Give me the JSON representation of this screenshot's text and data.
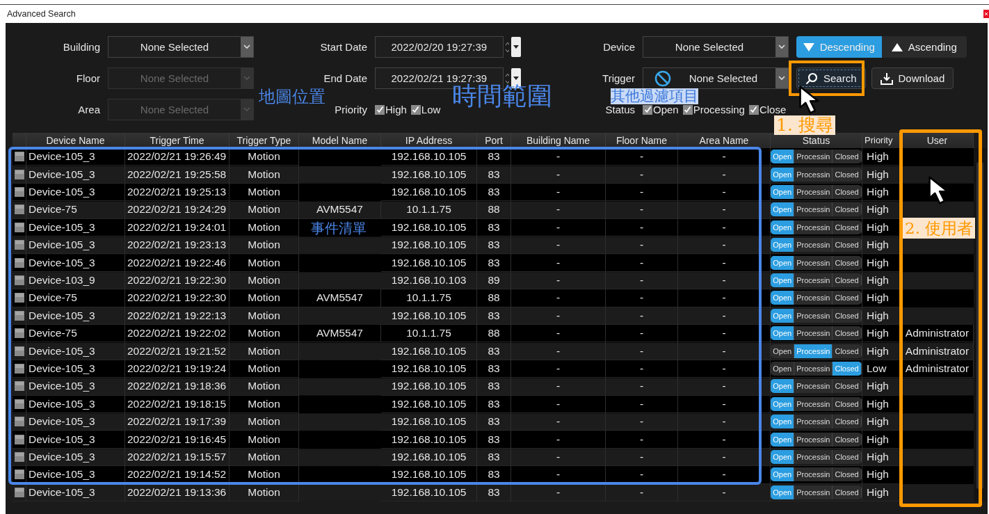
{
  "window": {
    "title": "Advanced Search"
  },
  "filters": {
    "location": [
      {
        "label": "Building",
        "value": "None Selected",
        "disabled": false
      },
      {
        "label": "Floor",
        "value": "None Selected",
        "disabled": true
      },
      {
        "label": "Area",
        "value": "None Selected",
        "disabled": true
      }
    ],
    "dates": [
      {
        "label": "Start Date",
        "value": "2022/02/20 19:27:39"
      },
      {
        "label": "End Date",
        "value": "2022/02/21 19:27:39"
      }
    ],
    "priority": {
      "label": "Priority",
      "options": [
        {
          "label": "High",
          "checked": true
        },
        {
          "label": "Low",
          "checked": true
        }
      ]
    },
    "device": {
      "label": "Device",
      "value": "None Selected"
    },
    "trigger": {
      "label": "Trigger",
      "value": "None Selected"
    },
    "status": {
      "label": "Status",
      "options": [
        {
          "label": "Open",
          "checked": true
        },
        {
          "label": "Processing",
          "checked": true
        },
        {
          "label": "Close",
          "checked": true
        }
      ]
    },
    "sort": [
      {
        "label": "Descending",
        "kind": "down",
        "selected": true
      },
      {
        "label": "Ascending",
        "kind": "up",
        "selected": false
      }
    ],
    "actions": [
      {
        "label": "Search",
        "kind": "search"
      },
      {
        "label": "Download",
        "kind": "download"
      }
    ]
  },
  "table": {
    "columns": [
      "Device Name",
      "Trigger Time",
      "Trigger Type",
      "Model Name",
      "IP Address",
      "Port",
      "Building Name",
      "Floor Name",
      "Area Name",
      "Status",
      "Priority",
      "User"
    ],
    "rows": [
      {
        "device": "Device-105_3",
        "time": "2022/02/21 19:26:49",
        "type": "Motion",
        "ip": "192.168.10.105",
        "port": "83",
        "building": "-",
        "floor": "-",
        "area": "-",
        "status": [
          {
            "label": "Open",
            "selected": true
          },
          {
            "label": "Processin",
            "selected": false
          },
          {
            "label": "Closed",
            "selected": false
          }
        ],
        "priority": "High"
      },
      {
        "device": "Device-105_3",
        "time": "2022/02/21 19:25:58",
        "type": "Motion",
        "ip": "192.168.10.105",
        "port": "83",
        "building": "-",
        "floor": "-",
        "area": "-",
        "status": [
          {
            "label": "Open",
            "selected": true
          },
          {
            "label": "Processin",
            "selected": false
          },
          {
            "label": "Closed",
            "selected": false
          }
        ],
        "priority": "High"
      },
      {
        "device": "Device-105_3",
        "time": "2022/02/21 19:25:13",
        "type": "Motion",
        "ip": "192.168.10.105",
        "port": "83",
        "building": "-",
        "floor": "-",
        "area": "-",
        "status": [
          {
            "label": "Open",
            "selected": true
          },
          {
            "label": "Processin",
            "selected": false
          },
          {
            "label": "Closed",
            "selected": false
          }
        ],
        "priority": "High"
      },
      {
        "device": "Device-75",
        "time": "2022/02/21 19:24:29",
        "type": "Motion",
        "model": "AVM5547",
        "ip": "10.1.1.75",
        "port": "88",
        "building": "-",
        "floor": "-",
        "area": "-",
        "status": [
          {
            "label": "Open",
            "selected": true
          },
          {
            "label": "Processin",
            "selected": false
          },
          {
            "label": "Closed",
            "selected": false
          }
        ],
        "priority": "High"
      },
      {
        "device": "Device-105_3",
        "time": "2022/02/21 19:24:01",
        "type": "Motion",
        "ip": "192.168.10.105",
        "port": "83",
        "building": "-",
        "floor": "-",
        "area": "-",
        "status": [
          {
            "label": "Open",
            "selected": true
          },
          {
            "label": "Processin",
            "selected": false
          },
          {
            "label": "Closed",
            "selected": false
          }
        ],
        "priority": "High"
      },
      {
        "device": "Device-105_3",
        "time": "2022/02/21 19:23:13",
        "type": "Motion",
        "ip": "192.168.10.105",
        "port": "83",
        "building": "-",
        "floor": "-",
        "area": "-",
        "status": [
          {
            "label": "Open",
            "selected": true
          },
          {
            "label": "Processin",
            "selected": false
          },
          {
            "label": "Closed",
            "selected": false
          }
        ],
        "priority": "High"
      },
      {
        "device": "Device-105_3",
        "time": "2022/02/21 19:22:46",
        "type": "Motion",
        "ip": "192.168.10.105",
        "port": "83",
        "building": "-",
        "floor": "-",
        "area": "-",
        "status": [
          {
            "label": "Open",
            "selected": true
          },
          {
            "label": "Processin",
            "selected": false
          },
          {
            "label": "Closed",
            "selected": false
          }
        ],
        "priority": "High"
      },
      {
        "device": "Device-103_9",
        "time": "2022/02/21 19:22:30",
        "type": "Motion",
        "ip": "192.168.10.103",
        "port": "89",
        "building": "-",
        "floor": "-",
        "area": "-",
        "status": [
          {
            "label": "Open",
            "selected": true
          },
          {
            "label": "Processin",
            "selected": false
          },
          {
            "label": "Closed",
            "selected": false
          }
        ],
        "priority": "High"
      },
      {
        "device": "Device-75",
        "time": "2022/02/21 19:22:30",
        "type": "Motion",
        "model": "AVM5547",
        "ip": "10.1.1.75",
        "port": "88",
        "building": "-",
        "floor": "-",
        "area": "-",
        "status": [
          {
            "label": "Open",
            "selected": true
          },
          {
            "label": "Processin",
            "selected": false
          },
          {
            "label": "Closed",
            "selected": false
          }
        ],
        "priority": "High"
      },
      {
        "device": "Device-105_3",
        "time": "2022/02/21 19:22:13",
        "type": "Motion",
        "ip": "192.168.10.105",
        "port": "83",
        "building": "-",
        "floor": "-",
        "area": "-",
        "status": [
          {
            "label": "Open",
            "selected": true
          },
          {
            "label": "Processin",
            "selected": false
          },
          {
            "label": "Closed",
            "selected": false
          }
        ],
        "priority": "High"
      },
      {
        "device": "Device-75",
        "time": "2022/02/21 19:22:02",
        "type": "Motion",
        "model": "AVM5547",
        "ip": "10.1.1.75",
        "port": "88",
        "building": "-",
        "floor": "-",
        "area": "-",
        "status": [
          {
            "label": "Open",
            "selected": true
          },
          {
            "label": "Processin",
            "selected": false
          },
          {
            "label": "Closed",
            "selected": false
          }
        ],
        "priority": "High",
        "user": "Administrator"
      },
      {
        "device": "Device-105_3",
        "time": "2022/02/21 19:21:52",
        "type": "Motion",
        "ip": "192.168.10.105",
        "port": "83",
        "building": "-",
        "floor": "-",
        "area": "-",
        "status": [
          {
            "label": "Open",
            "selected": false
          },
          {
            "label": "Processin",
            "selected": true
          },
          {
            "label": "Closed",
            "selected": false
          }
        ],
        "priority": "High",
        "user": "Administrator"
      },
      {
        "device": "Device-105_3",
        "time": "2022/02/21 19:19:24",
        "type": "Motion",
        "ip": "192.168.10.105",
        "port": "83",
        "building": "-",
        "floor": "-",
        "area": "-",
        "status": [
          {
            "label": "Open",
            "selected": false
          },
          {
            "label": "Processin",
            "selected": false
          },
          {
            "label": "Closed",
            "selected": true
          }
        ],
        "priority": "Low",
        "user": "Administrator"
      },
      {
        "device": "Device-105_3",
        "time": "2022/02/21 19:18:36",
        "type": "Motion",
        "ip": "192.168.10.105",
        "port": "83",
        "building": "-",
        "floor": "-",
        "area": "-",
        "status": [
          {
            "label": "Open",
            "selected": true
          },
          {
            "label": "Processin",
            "selected": false
          },
          {
            "label": "Closed",
            "selected": false
          }
        ],
        "priority": "High"
      },
      {
        "device": "Device-105_3",
        "time": "2022/02/21 19:18:15",
        "type": "Motion",
        "ip": "192.168.10.105",
        "port": "83",
        "building": "-",
        "floor": "-",
        "area": "-",
        "status": [
          {
            "label": "Open",
            "selected": true
          },
          {
            "label": "Processin",
            "selected": false
          },
          {
            "label": "Closed",
            "selected": false
          }
        ],
        "priority": "High"
      },
      {
        "device": "Device-105_3",
        "time": "2022/02/21 19:17:39",
        "type": "Motion",
        "ip": "192.168.10.105",
        "port": "83",
        "building": "-",
        "floor": "-",
        "area": "-",
        "status": [
          {
            "label": "Open",
            "selected": true
          },
          {
            "label": "Processin",
            "selected": false
          },
          {
            "label": "Closed",
            "selected": false
          }
        ],
        "priority": "High"
      },
      {
        "device": "Device-105_3",
        "time": "2022/02/21 19:16:45",
        "type": "Motion",
        "ip": "192.168.10.105",
        "port": "83",
        "building": "-",
        "floor": "-",
        "area": "-",
        "status": [
          {
            "label": "Open",
            "selected": true
          },
          {
            "label": "Processin",
            "selected": false
          },
          {
            "label": "Closed",
            "selected": false
          }
        ],
        "priority": "High"
      },
      {
        "device": "Device-105_3",
        "time": "2022/02/21 19:15:57",
        "type": "Motion",
        "ip": "192.168.10.105",
        "port": "83",
        "building": "-",
        "floor": "-",
        "area": "-",
        "status": [
          {
            "label": "Open",
            "selected": true
          },
          {
            "label": "Processin",
            "selected": false
          },
          {
            "label": "Closed",
            "selected": false
          }
        ],
        "priority": "High"
      },
      {
        "device": "Device-105_3",
        "time": "2022/02/21 19:14:52",
        "type": "Motion",
        "ip": "192.168.10.105",
        "port": "83",
        "building": "-",
        "floor": "-",
        "area": "-",
        "status": [
          {
            "label": "Open",
            "selected": true
          },
          {
            "label": "Processin",
            "selected": false
          },
          {
            "label": "Closed",
            "selected": false
          }
        ],
        "priority": "High"
      },
      {
        "device": "Device-105_3",
        "time": "2022/02/21 19:13:36",
        "type": "Motion",
        "ip": "192.168.10.105",
        "port": "83",
        "building": "-",
        "floor": "-",
        "area": "-",
        "status": [
          {
            "label": "Open",
            "selected": true
          },
          {
            "label": "Processin",
            "selected": false
          },
          {
            "label": "Closed",
            "selected": false
          }
        ],
        "priority": "High"
      }
    ]
  },
  "annotations": [
    {
      "text": "地圖位置"
    },
    {
      "text": "時間範圍"
    },
    {
      "text": "其他過濾項目"
    },
    {
      "text": "事件清單"
    },
    {
      "text": "1. 搜尋"
    },
    {
      "text": "2. 使用者"
    }
  ]
}
